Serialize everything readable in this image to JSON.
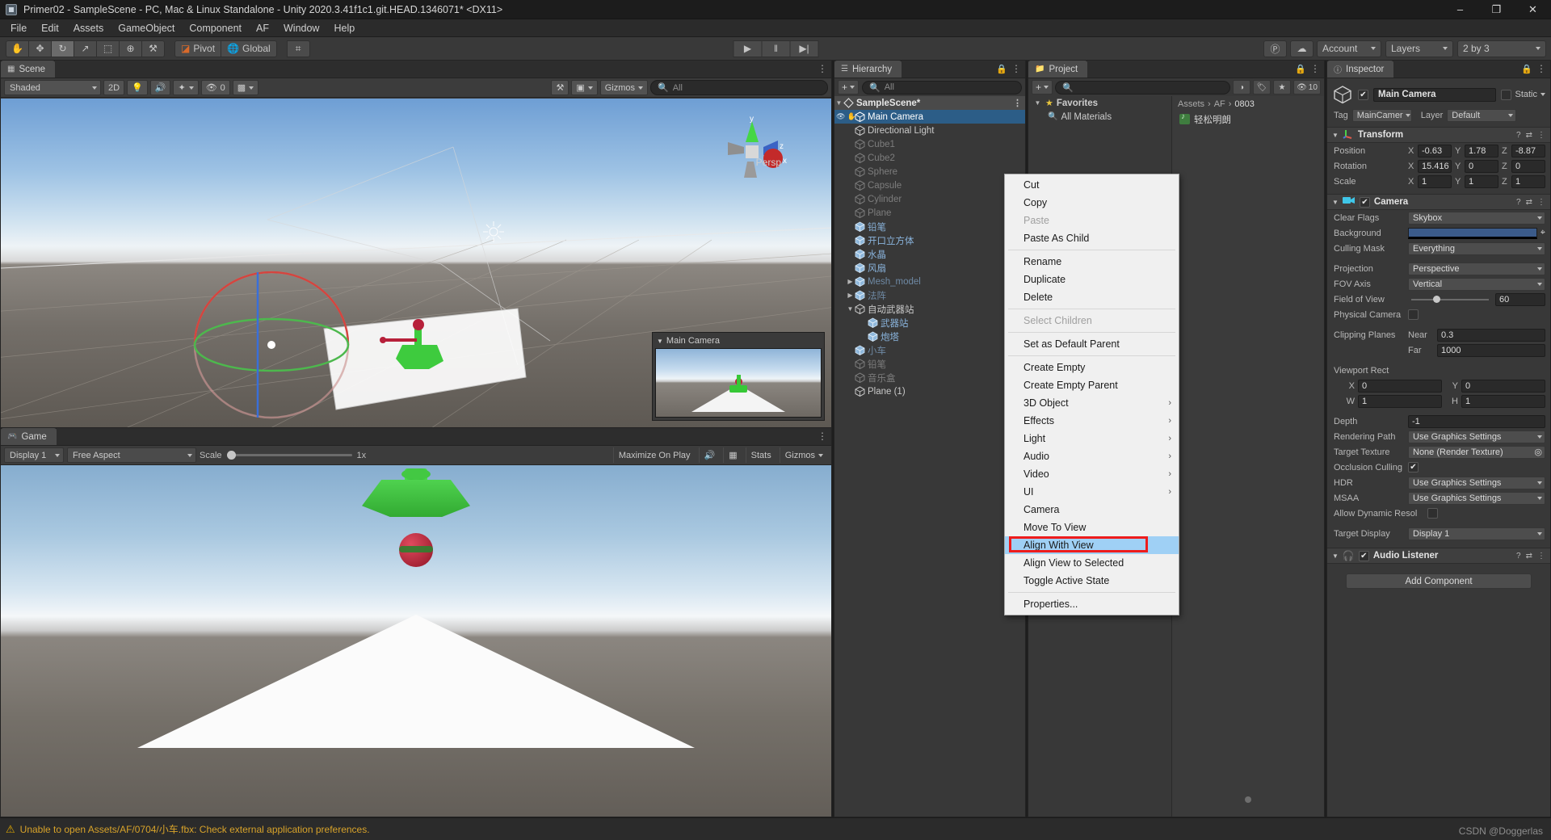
{
  "window": {
    "title": "Primer02 - SampleScene - PC, Mac & Linux Standalone - Unity 2020.3.41f1c1.git.HEAD.1346071* <DX11>",
    "minimize": "–",
    "maximize": "❐",
    "close": "✕"
  },
  "menubar": {
    "items": [
      "File",
      "Edit",
      "Assets",
      "GameObject",
      "Component",
      "AF",
      "Window",
      "Help"
    ]
  },
  "toolbar": {
    "tools": [
      {
        "name": "hand-tool",
        "glyph": "✋",
        "active": false
      },
      {
        "name": "move-tool",
        "glyph": "✥",
        "active": false
      },
      {
        "name": "rotate-tool",
        "glyph": "↻",
        "active": true
      },
      {
        "name": "scale-tool",
        "glyph": "↗",
        "active": false
      },
      {
        "name": "rect-tool",
        "glyph": "⬚",
        "active": false
      },
      {
        "name": "transform-tool",
        "glyph": "⊕",
        "active": false
      },
      {
        "name": "custom-tool",
        "glyph": "⚒",
        "active": false
      }
    ],
    "pivot_label": "Pivot",
    "global_label": "Global",
    "snap_glyph": "⌗",
    "play": "▶",
    "pause": "‖",
    "step": "▶|",
    "collab_glyph": "Ⓟ",
    "cloud_glyph": "☁",
    "account_label": "Account",
    "layers_label": "Layers",
    "layout_label": "2 by 3"
  },
  "scene": {
    "tab_label": "Scene",
    "tab_icon": "grid-icon",
    "shading_mode": "Shaded",
    "mode_2d": "2D",
    "lighting_glyph": "Ὂ1",
    "audio_glyph": "ὐA",
    "fx_glyph": "✨",
    "hidden_count": "0",
    "grid_glyph": "⌗",
    "tools_glyph": "⚒",
    "camera_glyph": "▣",
    "gizmos_label": "Gizmos",
    "search_placeholder": "All",
    "gizmo_axis_y": "y",
    "gizmo_axis_x": "x",
    "gizmo_axis_z": "z",
    "persp_label": "Persp",
    "preview_title": "Main Camera"
  },
  "game": {
    "tab_label": "Game",
    "display": "Display 1",
    "aspect": "Free Aspect",
    "scale_label": "Scale",
    "scale_value": "1x",
    "maximize_on_play": "Maximize On Play",
    "mute_glyph": "ὐA",
    "stats_glyph": "▦",
    "stats_label": "Stats",
    "gizmos_label": "Gizmos"
  },
  "hierarchy": {
    "tab_label": "Hierarchy",
    "tab_icon": "list-icon",
    "add_label": "+",
    "search_placeholder": "All",
    "scene_name": "SampleScene*",
    "items": [
      {
        "label": "Main Camera",
        "depth": 1,
        "icon": "gameobject-icon",
        "state": "selected",
        "arrow": "",
        "eye": true
      },
      {
        "label": "Directional Light",
        "depth": 1,
        "icon": "gameobject-icon",
        "state": "normal",
        "arrow": ""
      },
      {
        "label": "Cube1",
        "depth": 1,
        "icon": "gameobject-icon",
        "state": "dim",
        "arrow": ""
      },
      {
        "label": "Cube2",
        "depth": 1,
        "icon": "gameobject-icon",
        "state": "dim",
        "arrow": ""
      },
      {
        "label": "Sphere",
        "depth": 1,
        "icon": "gameobject-icon",
        "state": "dim",
        "arrow": ""
      },
      {
        "label": "Capsule",
        "depth": 1,
        "icon": "gameobject-icon",
        "state": "dim",
        "arrow": ""
      },
      {
        "label": "Cylinder",
        "depth": 1,
        "icon": "gameobject-icon",
        "state": "dim",
        "arrow": ""
      },
      {
        "label": "Plane",
        "depth": 1,
        "icon": "gameobject-icon",
        "state": "dim",
        "arrow": ""
      },
      {
        "label": "铅笔",
        "depth": 1,
        "icon": "prefab-icon",
        "state": "blue",
        "arrow": ""
      },
      {
        "label": "开口立方体",
        "depth": 1,
        "icon": "prefab-icon",
        "state": "blue",
        "arrow": ""
      },
      {
        "label": "水晶",
        "depth": 1,
        "icon": "prefab-icon",
        "state": "blue",
        "arrow": ""
      },
      {
        "label": "风扇",
        "depth": 1,
        "icon": "prefab-icon",
        "state": "blue",
        "arrow": ""
      },
      {
        "label": "Mesh_model",
        "depth": 1,
        "icon": "prefab-icon",
        "state": "bluedim",
        "arrow": "▶"
      },
      {
        "label": "法阵",
        "depth": 1,
        "icon": "prefab-icon",
        "state": "bluedim",
        "arrow": "▶"
      },
      {
        "label": "自动武器站",
        "depth": 1,
        "icon": "gameobject-icon",
        "state": "normal",
        "arrow": "▼"
      },
      {
        "label": "武器站",
        "depth": 2,
        "icon": "prefab-icon",
        "state": "blue",
        "arrow": ""
      },
      {
        "label": "炮塔",
        "depth": 2,
        "icon": "prefab-icon",
        "state": "blue",
        "arrow": ""
      },
      {
        "label": "小车",
        "depth": 1,
        "icon": "prefab-icon",
        "state": "bluedim",
        "arrow": ""
      },
      {
        "label": "铅笔",
        "depth": 1,
        "icon": "gameobject-icon",
        "state": "dim",
        "arrow": ""
      },
      {
        "label": "音乐盒",
        "depth": 1,
        "icon": "gameobject-icon",
        "state": "dim",
        "arrow": ""
      },
      {
        "label": "Plane (1)",
        "depth": 1,
        "icon": "gameobject-icon",
        "state": "normal",
        "arrow": ""
      }
    ]
  },
  "project": {
    "tab_label": "Project",
    "tab_icon": "folder-icon",
    "add_label": "+",
    "search_placeholder": "",
    "icon_buttons": [
      "package-icon",
      "label-icon",
      "star-icon"
    ],
    "hidden_count": "10",
    "favorites_label": "Favorites",
    "favorites_children": [
      "All Materials"
    ],
    "breadcrumbs": [
      "Assets",
      "AF",
      "0803"
    ],
    "assets": [
      {
        "label": "轻松明朗",
        "icon": "audio-clip-icon"
      }
    ]
  },
  "inspector": {
    "tab_label": "Inspector",
    "tab_icon": "info-icon",
    "object_name": "Main Camera",
    "object_enabled": true,
    "static_label": "Static",
    "tag_label": "Tag",
    "tag_value": "MainCamer",
    "layer_label": "Layer",
    "layer_value": "Default",
    "components": [
      {
        "name": "Transform",
        "icon": "transform-icon",
        "rows": [
          {
            "label": "Position",
            "fields": [
              {
                "axis": "X",
                "value": "-0.63"
              },
              {
                "axis": "Y",
                "value": "1.78"
              },
              {
                "axis": "Z",
                "value": "-8.87"
              }
            ]
          },
          {
            "label": "Rotation",
            "fields": [
              {
                "axis": "X",
                "value": "15.416"
              },
              {
                "axis": "Y",
                "value": "0"
              },
              {
                "axis": "Z",
                "value": "0"
              }
            ]
          },
          {
            "label": "Scale",
            "fields": [
              {
                "axis": "X",
                "value": "1"
              },
              {
                "axis": "Y",
                "value": "1"
              },
              {
                "axis": "Z",
                "value": "1"
              }
            ]
          }
        ]
      }
    ],
    "camera": {
      "name": "Camera",
      "icon": "camera-icon",
      "enabled": true,
      "clear_flags_label": "Clear Flags",
      "clear_flags_value": "Skybox",
      "background_label": "Background",
      "background_color": "#3b5b8a",
      "culling_mask_label": "Culling Mask",
      "culling_mask_value": "Everything",
      "projection_label": "Projection",
      "projection_value": "Perspective",
      "fov_axis_label": "FOV Axis",
      "fov_axis_value": "Vertical",
      "field_of_view_label": "Field of View",
      "field_of_view_value": "60",
      "physical_camera_label": "Physical Camera",
      "physical_camera_checked": false,
      "clipping_planes_label": "Clipping Planes",
      "near_label": "Near",
      "near_value": "0.3",
      "far_label": "Far",
      "far_value": "1000",
      "viewport_rect_label": "Viewport Rect",
      "viewport_x_label": "X",
      "viewport_x": "0",
      "viewport_y_label": "Y",
      "viewport_y": "0",
      "viewport_w_label": "W",
      "viewport_w": "1",
      "viewport_h_label": "H",
      "viewport_h": "1",
      "depth_label": "Depth",
      "depth_value": "-1",
      "rendering_path_label": "Rendering Path",
      "rendering_path_value": "Use Graphics Settings",
      "target_texture_label": "Target Texture",
      "target_texture_value": "None (Render Texture)",
      "occlusion_culling_label": "Occlusion Culling",
      "occlusion_culling_checked": true,
      "hdr_label": "HDR",
      "hdr_value": "Use Graphics Settings",
      "msaa_label": "MSAA",
      "msaa_value": "Use Graphics Settings",
      "allow_dynamic_label": "Allow Dynamic Resol",
      "allow_dynamic_checked": false,
      "target_display_label": "Target Display",
      "target_display_value": "Display 1"
    },
    "audio_listener": {
      "name": "Audio Listener",
      "icon": "headphones-icon",
      "enabled": true
    },
    "add_component_label": "Add Component"
  },
  "context_menu": {
    "items": [
      {
        "label": "Cut",
        "state": "normal",
        "submenu": false
      },
      {
        "label": "Copy",
        "state": "normal",
        "submenu": false
      },
      {
        "label": "Paste",
        "state": "disabled",
        "submenu": false
      },
      {
        "label": "Paste As Child",
        "state": "normal",
        "submenu": false
      },
      {
        "separator": true
      },
      {
        "label": "Rename",
        "state": "normal",
        "submenu": false
      },
      {
        "label": "Duplicate",
        "state": "normal",
        "submenu": false
      },
      {
        "label": "Delete",
        "state": "normal",
        "submenu": false
      },
      {
        "separator": true
      },
      {
        "label": "Select Children",
        "state": "disabled",
        "submenu": false
      },
      {
        "separator": true
      },
      {
        "label": "Set as Default Parent",
        "state": "normal",
        "submenu": false
      },
      {
        "separator": true
      },
      {
        "label": "Create Empty",
        "state": "normal",
        "submenu": false
      },
      {
        "label": "Create Empty Parent",
        "state": "normal",
        "submenu": false
      },
      {
        "label": "3D Object",
        "state": "normal",
        "submenu": true
      },
      {
        "label": "Effects",
        "state": "normal",
        "submenu": true
      },
      {
        "label": "Light",
        "state": "normal",
        "submenu": true
      },
      {
        "label": "Audio",
        "state": "normal",
        "submenu": true
      },
      {
        "label": "Video",
        "state": "normal",
        "submenu": true
      },
      {
        "label": "UI",
        "state": "normal",
        "submenu": true
      },
      {
        "label": "Camera",
        "state": "normal",
        "submenu": false
      },
      {
        "label": "Move To View",
        "state": "normal",
        "submenu": false
      },
      {
        "label": "Align With View",
        "state": "highlighted",
        "submenu": false
      },
      {
        "label": "Align View to Selected",
        "state": "normal",
        "submenu": false
      },
      {
        "label": "Toggle Active State",
        "state": "normal",
        "submenu": false
      },
      {
        "separator": true
      },
      {
        "label": "Properties...",
        "state": "normal",
        "submenu": false
      }
    ],
    "highlight_color": "#9fd0f5",
    "annotation_box_color": "#ee1c1c"
  },
  "statusbar": {
    "warning_icon": "warning-icon",
    "message": "Unable to open Assets/AF/0704/小车.fbx: Check external application preferences.",
    "watermark": "CSDN @Doggerlas"
  }
}
